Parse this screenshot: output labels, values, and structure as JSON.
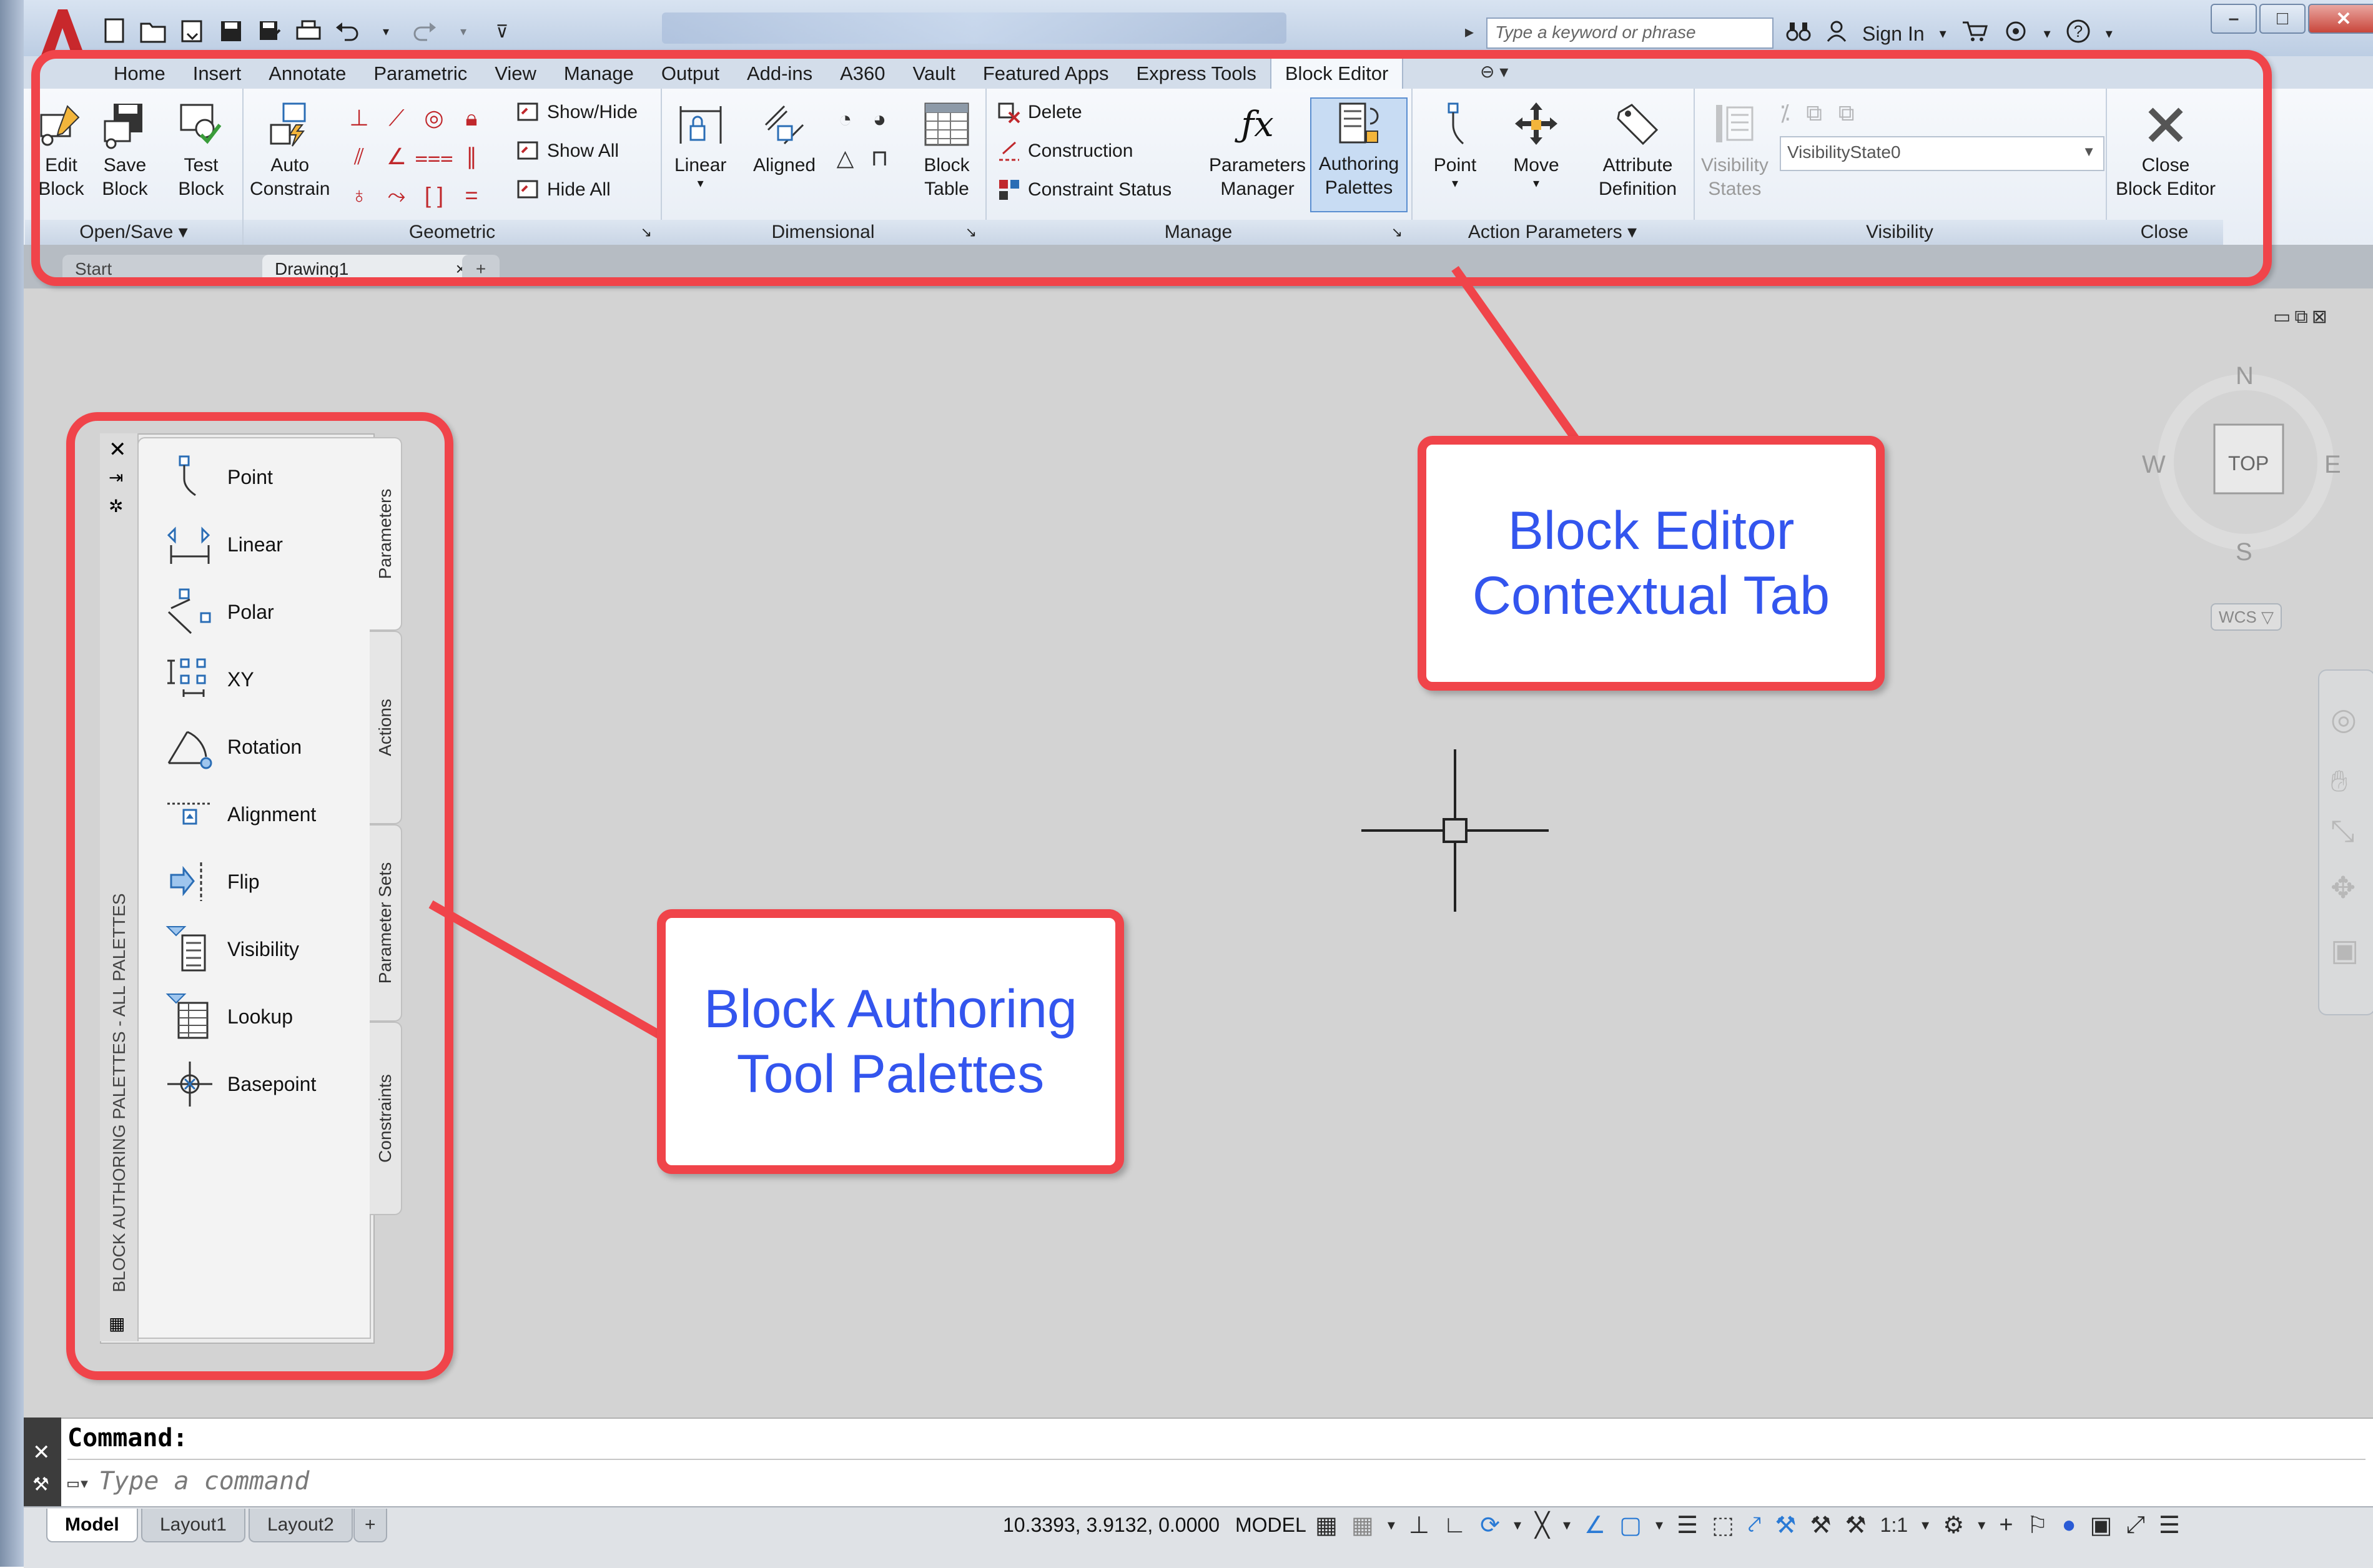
{
  "titlebar": {
    "search_placeholder": "Type a keyword or phrase",
    "sign_in": "Sign In",
    "help": "?"
  },
  "ribbon_tabs": [
    "Home",
    "Insert",
    "Annotate",
    "Parametric",
    "View",
    "Manage",
    "Output",
    "Add-ins",
    "A360",
    "Vault",
    "Featured Apps",
    "Express Tools",
    "Block Editor"
  ],
  "active_tab": "Block Editor",
  "panels": {
    "open_save": {
      "title": "Open/Save",
      "edit_block": "Edit\nBlock",
      "edit_l1": "Edit",
      "edit_l2": "Block",
      "save_l1": "Save",
      "save_l2": "Block"
    },
    "test": {
      "l1": "Test",
      "l2": "Block"
    },
    "geometric": {
      "title": "Geometric",
      "auto_l1": "Auto",
      "auto_l2": "Constrain",
      "show_hide": "Show/Hide",
      "show_all": "Show All",
      "hide_all": "Hide All"
    },
    "dimensional": {
      "title": "Dimensional",
      "linear": "Linear",
      "aligned": "Aligned",
      "block_l1": "Block",
      "block_l2": "Table"
    },
    "manage": {
      "title": "Manage",
      "delete": "Delete",
      "construction": "Construction",
      "constraint_status": "Constraint Status",
      "params_l1": "Parameters",
      "params_l2": "Manager",
      "auth_l1": "Authoring",
      "auth_l2": "Palettes"
    },
    "action_params": {
      "title": "Action Parameters",
      "point": "Point",
      "move": "Move",
      "attr_l1": "Attribute",
      "attr_l2": "Definition"
    },
    "visibility": {
      "title": "Visibility",
      "vis_l1": "Visibility",
      "vis_l2": "States",
      "state_value": "VisibilityState0"
    },
    "close": {
      "title": "Close",
      "l1": "Close",
      "l2": "Block Editor"
    }
  },
  "doc_tabs": {
    "start": "Start",
    "drawing": "Drawing1"
  },
  "viewcube": {
    "n": "N",
    "s": "S",
    "e": "E",
    "w": "W",
    "top": "TOP",
    "wcs": "WCS"
  },
  "palette": {
    "title": "BLOCK AUTHORING PALETTES - ALL PALETTES",
    "items": [
      "Point",
      "Linear",
      "Polar",
      "XY",
      "Rotation",
      "Alignment",
      "Flip",
      "Visibility",
      "Lookup",
      "Basepoint"
    ],
    "tabs": [
      "Parameters",
      "Actions",
      "Parameter Sets",
      "Constraints"
    ]
  },
  "callouts": {
    "ribbon_l1": "Block Editor",
    "ribbon_l2": "Contextual Tab",
    "palette_l1": "Block Authoring",
    "palette_l2": "Tool Palettes"
  },
  "command": {
    "label": "Command:",
    "placeholder": "Type a command"
  },
  "status": {
    "tabs": [
      "Model",
      "Layout1",
      "Layout2"
    ],
    "coords": "10.3393, 3.9132, 0.0000",
    "space": "MODEL",
    "scale": "1:1"
  },
  "colors": {
    "callout_border": "#f0444a",
    "callout_text": "#3355ee",
    "canvas": "#d3d3d3"
  }
}
